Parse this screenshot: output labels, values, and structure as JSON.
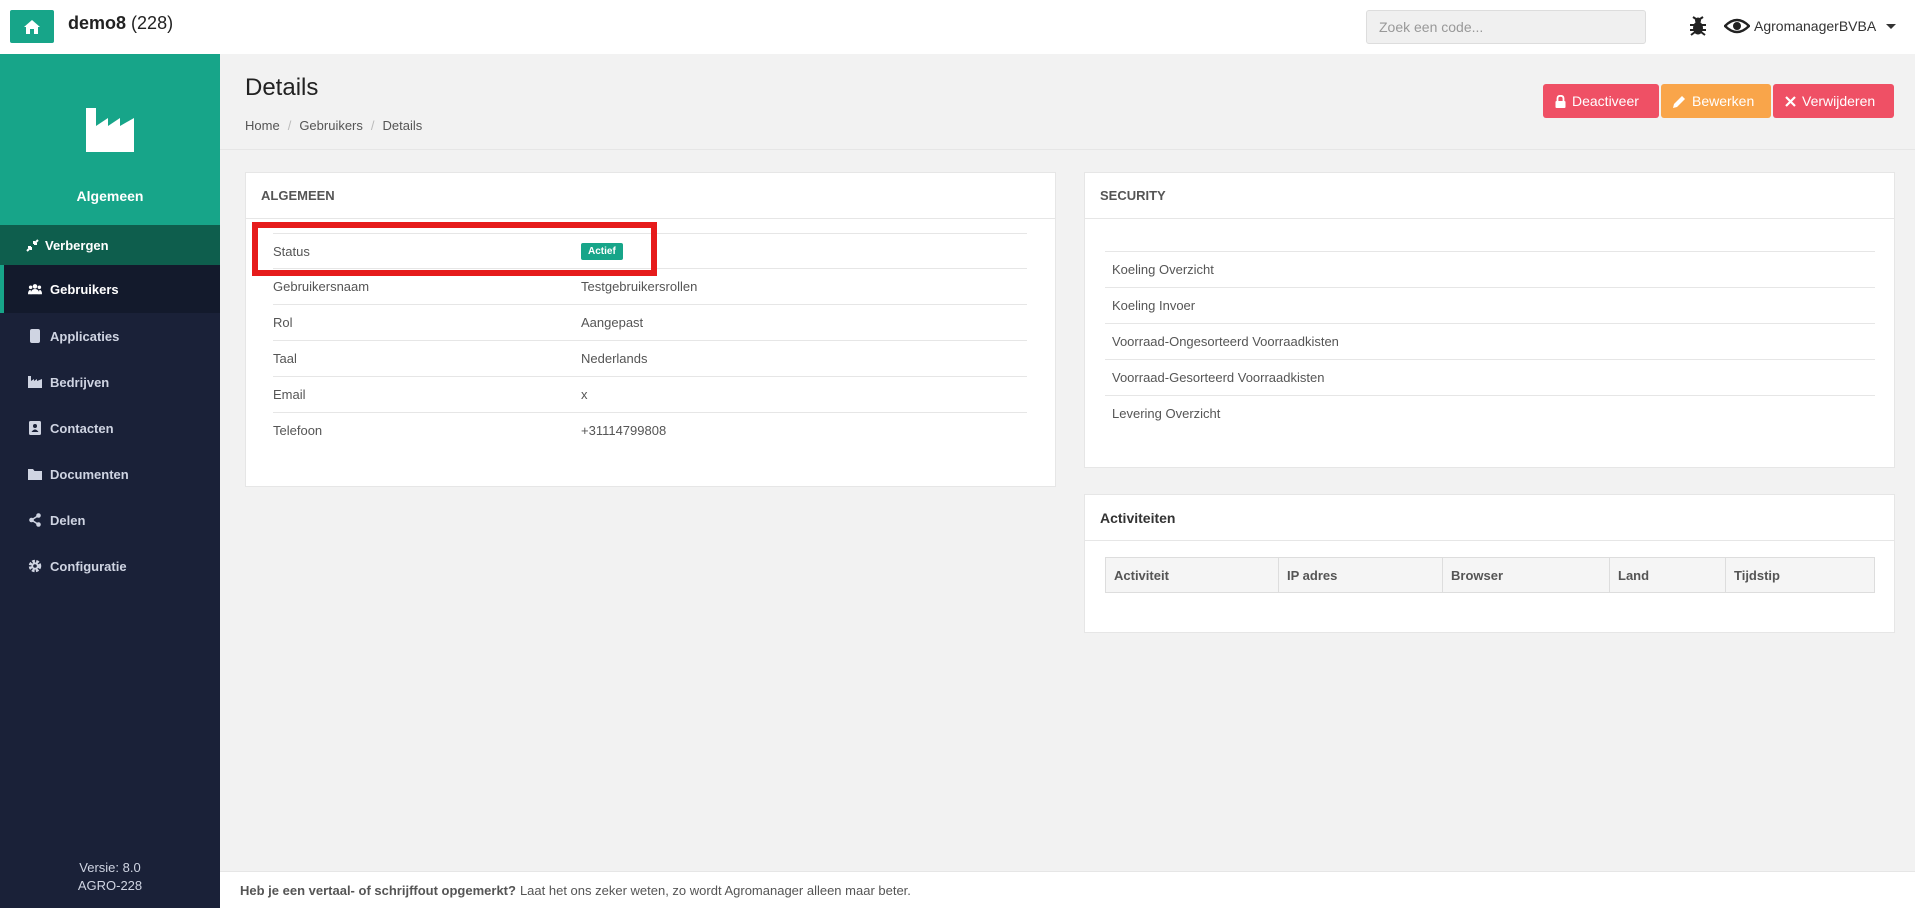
{
  "topbar": {
    "app_name": "demo8",
    "app_count": "(228)",
    "search_placeholder": "Zoek een code...",
    "user_name": "AgromanagerBVBA"
  },
  "sidebar": {
    "header_label": "Algemeen",
    "hide_label": "Verbergen",
    "items": [
      {
        "label": "Gebruikers",
        "icon": "users-icon"
      },
      {
        "label": "Applicaties",
        "icon": "phone-icon"
      },
      {
        "label": "Bedrijven",
        "icon": "factory-icon"
      },
      {
        "label": "Contacten",
        "icon": "address-book-icon"
      },
      {
        "label": "Documenten",
        "icon": "folder-icon"
      },
      {
        "label": "Delen",
        "icon": "share-icon"
      },
      {
        "label": "Configuratie",
        "icon": "gear-icon"
      }
    ],
    "version": "Versie: 8.0",
    "build": "AGRO-228"
  },
  "page": {
    "title": "Details",
    "breadcrumb": [
      "Home",
      "Gebruikers",
      "Details"
    ],
    "buttons": {
      "deactivate": "Deactiveer",
      "edit": "Bewerken",
      "delete": "Verwijderen"
    }
  },
  "general": {
    "title": "ALGEMEEN",
    "rows": [
      {
        "label": "Status",
        "value": "Actief"
      },
      {
        "label": "Gebruikersnaam",
        "value": "Testgebruikersrollen"
      },
      {
        "label": "Rol",
        "value": "Aangepast"
      },
      {
        "label": "Taal",
        "value": "Nederlands"
      },
      {
        "label": "Email",
        "value": "x"
      },
      {
        "label": "Telefoon",
        "value": "+31114799808"
      }
    ]
  },
  "security": {
    "title": "SECURITY",
    "items": [
      "Koeling Overzicht",
      "Koeling Invoer",
      "Voorraad-Ongesorteerd Voorraadkisten",
      "Voorraad-Gesorteerd Voorraadkisten",
      "Levering Overzicht"
    ]
  },
  "activity": {
    "title": "Activiteiten",
    "columns": [
      "Activiteit",
      "IP adres",
      "Browser",
      "Land",
      "Tijdstip"
    ]
  },
  "footer": {
    "bold": "Heb je een vertaal- of schrijffout opgemerkt?",
    "text": "Laat het ons zeker weten, zo wordt Agromanager alleen maar beter."
  },
  "colors": {
    "brand": "#17a589",
    "sidebar": "#1a2138",
    "danger": "#ef5065",
    "warning": "#f9a54a",
    "highlight": "#e61b1b"
  }
}
